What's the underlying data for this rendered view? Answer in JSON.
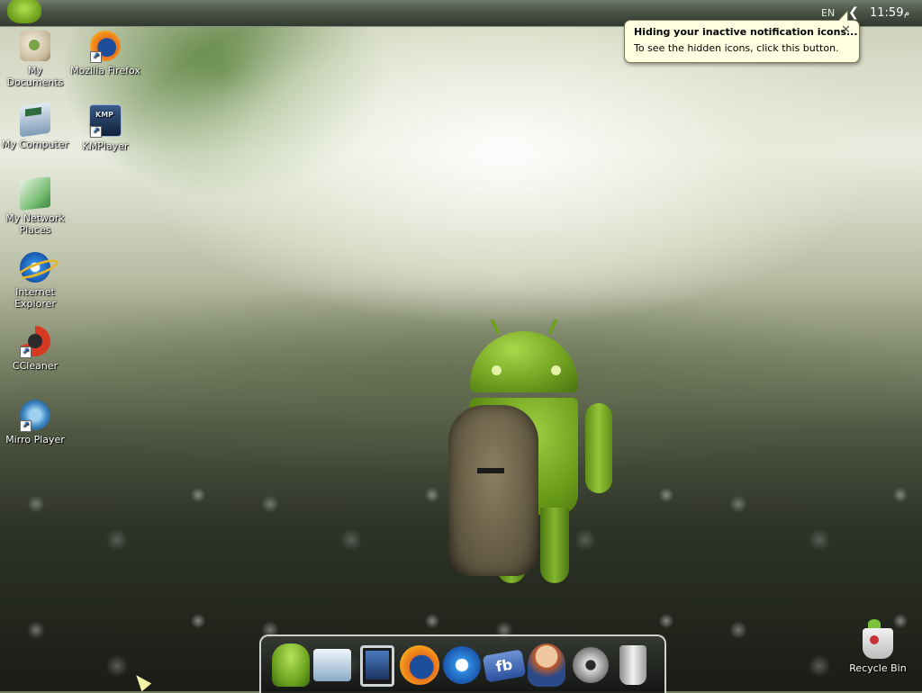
{
  "topbar": {
    "language": "EN",
    "tray_toggle": "❮",
    "clock": "11:59",
    "ampm": "م"
  },
  "balloon": {
    "title": "Hiding your inactive notification icons...",
    "text": "To see the hidden icons, click this button.",
    "close": "✕"
  },
  "desktop_icons": [
    {
      "label": "My Documents",
      "icon": "documents-icon"
    },
    {
      "label": "Mozilla Firefox",
      "icon": "firefox-icon"
    },
    {
      "label": "My Computer",
      "icon": "computer-icon"
    },
    {
      "label": "KMPlayer",
      "icon": "kmplayer-icon"
    },
    {
      "label": "My Network Places",
      "icon": "network-places-icon"
    },
    {
      "label": "Internet Explorer",
      "icon": "internet-explorer-icon"
    },
    {
      "label": "CCleaner",
      "icon": "ccleaner-icon"
    },
    {
      "label": "Mirro Player",
      "icon": "mirro-player-icon"
    },
    {
      "label": "Recycle Bin",
      "icon": "recycle-bin-icon"
    }
  ],
  "dock": {
    "items": [
      "android-icon",
      "network-icon",
      "tablet-icon",
      "firefox-icon",
      "internet-explorer-icon",
      "facebook-icon",
      "support-icon",
      "settings-icon",
      "trash-icon"
    ],
    "facebook_text": "fb"
  }
}
